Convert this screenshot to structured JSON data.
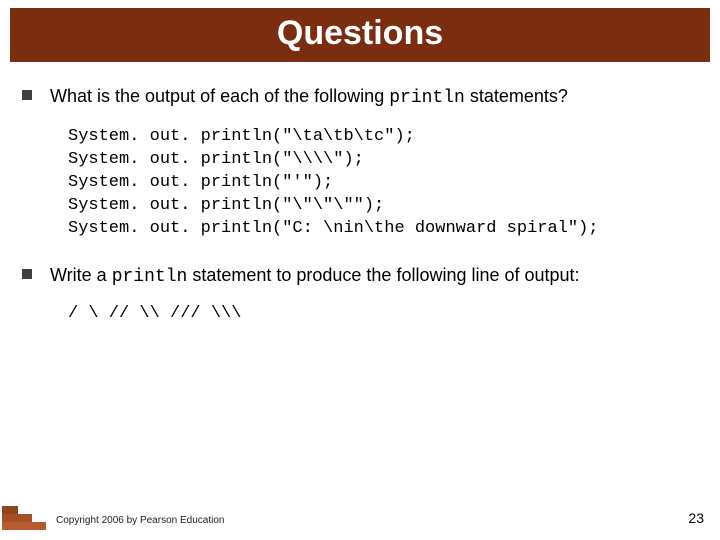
{
  "title": "Questions",
  "q1": {
    "pre": "What is the output of each of the following ",
    "mono": "println",
    "post": " statements?",
    "code": "System. out. println(\"\\ta\\tb\\tc\");\nSystem. out. println(\"\\\\\\\\\");\nSystem. out. println(\"'\");\nSystem. out. println(\"\\\"\\\"\\\"\");\nSystem. out. println(\"C: \\nin\\the downward spiral\");"
  },
  "q2": {
    "pre": "Write a ",
    "mono": "println",
    "post": " statement to produce the following line of output:",
    "output": "/ \\ // \\\\ /// \\\\\\"
  },
  "footer": {
    "copyright": "Copyright 2006 by Pearson Education",
    "page": "23"
  }
}
